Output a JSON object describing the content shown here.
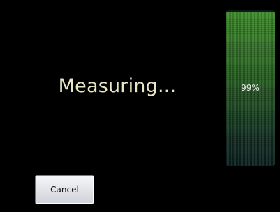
{
  "status": {
    "text": "Measuring..."
  },
  "progress": {
    "percent_label": "99%",
    "fraction": 0.99,
    "fill_color": "#2f6d25"
  },
  "actions": {
    "cancel_label": "Cancel"
  },
  "colors": {
    "background": "#000000",
    "status_text": "#e8e6c4"
  }
}
